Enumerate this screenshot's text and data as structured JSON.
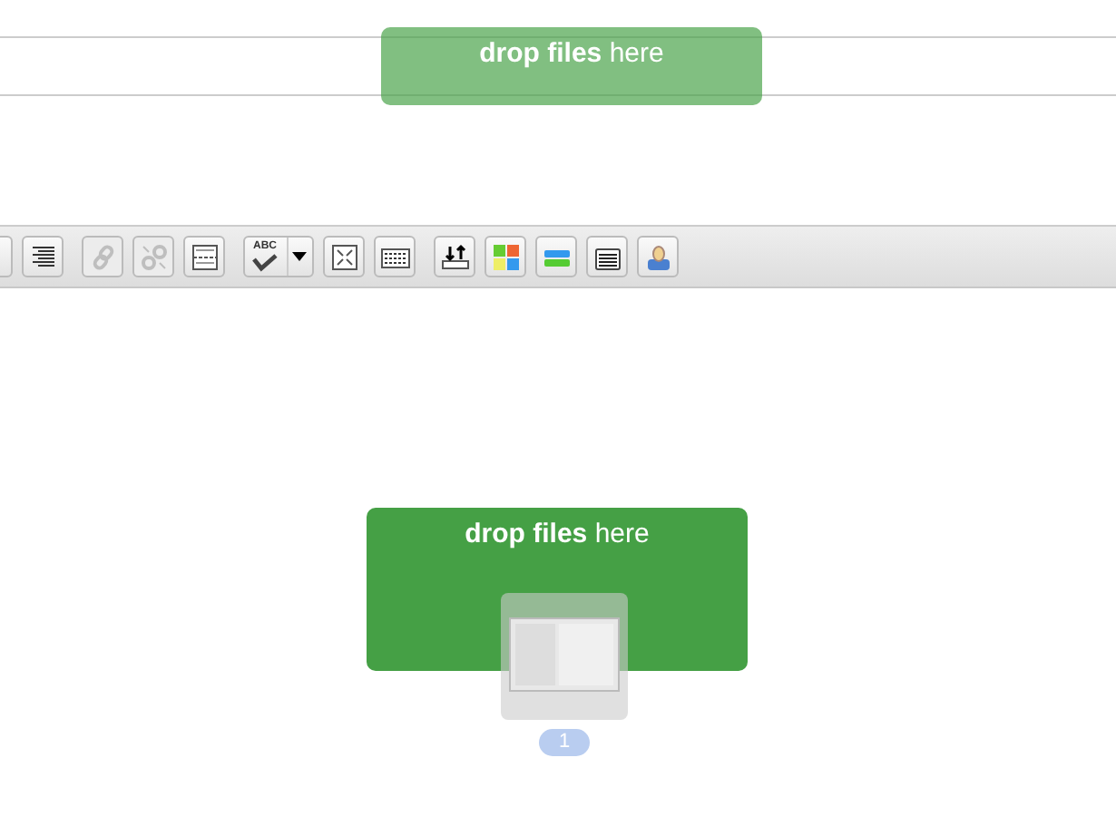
{
  "title_field": {
    "drop_zone": {
      "label": "**drop files** here",
      "faded": true
    }
  },
  "toolbar": {
    "groups": [
      [
        {
          "kind": "partial"
        },
        {
          "kind": "align",
          "disabled": false
        }
      ],
      [
        {
          "kind": "link",
          "disabled": true
        },
        {
          "kind": "unlink",
          "disabled": true
        },
        {
          "kind": "pagebreak",
          "disabled": false
        }
      ],
      [
        {
          "kind": "spellcheck",
          "label": "ABC",
          "disabled": false
        },
        {
          "kind": "fullscreen",
          "disabled": false
        },
        {
          "kind": "keyboard",
          "disabled": false
        }
      ],
      [
        {
          "kind": "upload",
          "disabled": false
        },
        {
          "kind": "colors",
          "disabled": false
        },
        {
          "kind": "bars",
          "disabled": false
        },
        {
          "kind": "lines",
          "disabled": false
        },
        {
          "kind": "person",
          "disabled": false
        }
      ]
    ]
  },
  "editor": {
    "drop_zone": {
      "label": "**drop files** here",
      "faded": false
    },
    "dragged_file": {
      "count": "1"
    }
  }
}
